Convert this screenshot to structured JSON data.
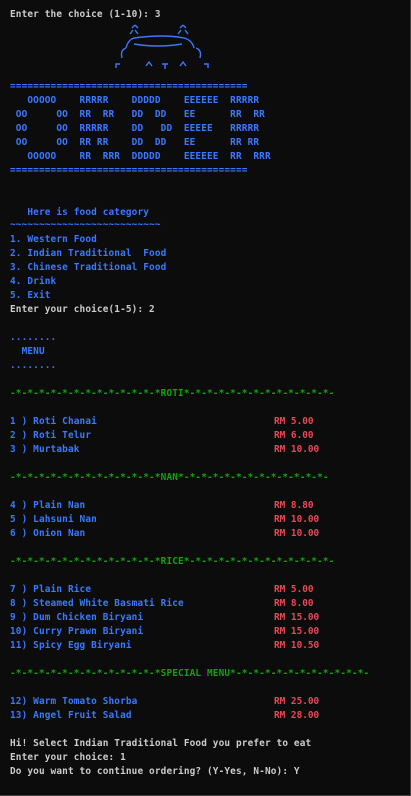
{
  "prompt_top": "Enter the choice (1-10): 3",
  "art_rule": "=========================================",
  "order_art": [
    "   OOOOO    RRRRR    DDDDD    EEEEEE  RRRRR",
    " OO     OO  RR  RR   DD  DD   EE      RR  RR",
    " OO     OO  RRRRR    DD   DD  EEEEE   RRRRR",
    " OO     OO  RR RR    DD  DD   EE      RR RR",
    "   OOOOO    RR  RRR  DDDDD    EEEEEE  RR  RRR"
  ],
  "category": {
    "heading": "   Here is food category",
    "underline": "~~~~~~~~~~~~~~~~~~~~~~~~~~",
    "options": [
      "1. Western Food",
      "2. Indian Traditional  Food",
      "3. Chinese Traditional Food",
      "4. Drink",
      "5. Exit"
    ],
    "prompt": "Enter your choice(1-5): 2"
  },
  "menu_header": {
    "dots1": "........",
    "title": "  MENU",
    "dots2": "........"
  },
  "sections": [
    {
      "divider": "-*-*-*-*-*-*-*-*-*-*-*-*-*ROTI*-*-*-*-*-*-*-*-*-*-*-*-*-",
      "items": [
        {
          "name": "1 ) Roti Chanai",
          "price": "RM 5.00"
        },
        {
          "name": "2 ) Roti Telur",
          "price": "RM 6.00"
        },
        {
          "name": "3 ) Murtabak",
          "price": "RM 10.00"
        }
      ]
    },
    {
      "divider": "-*-*-*-*-*-*-*-*-*-*-*-*-*NAN*-*-*-*-*-*-*-*-*-*-*-*-*-",
      "items": [
        {
          "name": "4 ) Plain Nan",
          "price": "RM 8.80"
        },
        {
          "name": "5 ) Lahsuni Nan",
          "price": "RM 10.00"
        },
        {
          "name": "6 ) Onion Nan",
          "price": "RM 10.00"
        }
      ]
    },
    {
      "divider": "-*-*-*-*-*-*-*-*-*-*-*-*-*RICE*-*-*-*-*-*-*-*-*-*-*-*-*-",
      "items": [
        {
          "name": "7 ) Plain Rice",
          "price": "RM 5.00"
        },
        {
          "name": "8 ) Steamed White Basmati Rice",
          "price": "RM 8.00"
        },
        {
          "name": "9 ) Dum Chicken Biryani",
          "price": "RM 15.00"
        },
        {
          "name": "10) Curry Prawn Biryani",
          "price": "RM 15.00"
        },
        {
          "name": "11) Spicy Egg Biryani",
          "price": "RM 10.50"
        }
      ]
    },
    {
      "divider": "-*-*-*-*-*-*-*-*-*-*-*-*-*SPECIAL MENU*-*-*-*-*-*-*-*-*-*-*-*-",
      "items": [
        {
          "name": "12) Warm Tomato Shorba",
          "price": "RM 25.00"
        },
        {
          "name": "13) Angel Fruit Salad",
          "price": "RM 28.00"
        }
      ]
    }
  ],
  "footer": {
    "line1": "Hi! Select Indian Traditional Food you prefer to eat",
    "line2": "Enter your choice: 1",
    "line3": "Do you want to continue ordering? (Y-Yes, N-No): Y"
  },
  "colors": {
    "background": "#0c0c0c",
    "text": "#cccccc",
    "blue": "#3b78ff",
    "green": "#13a10e",
    "red": "#e74856"
  }
}
